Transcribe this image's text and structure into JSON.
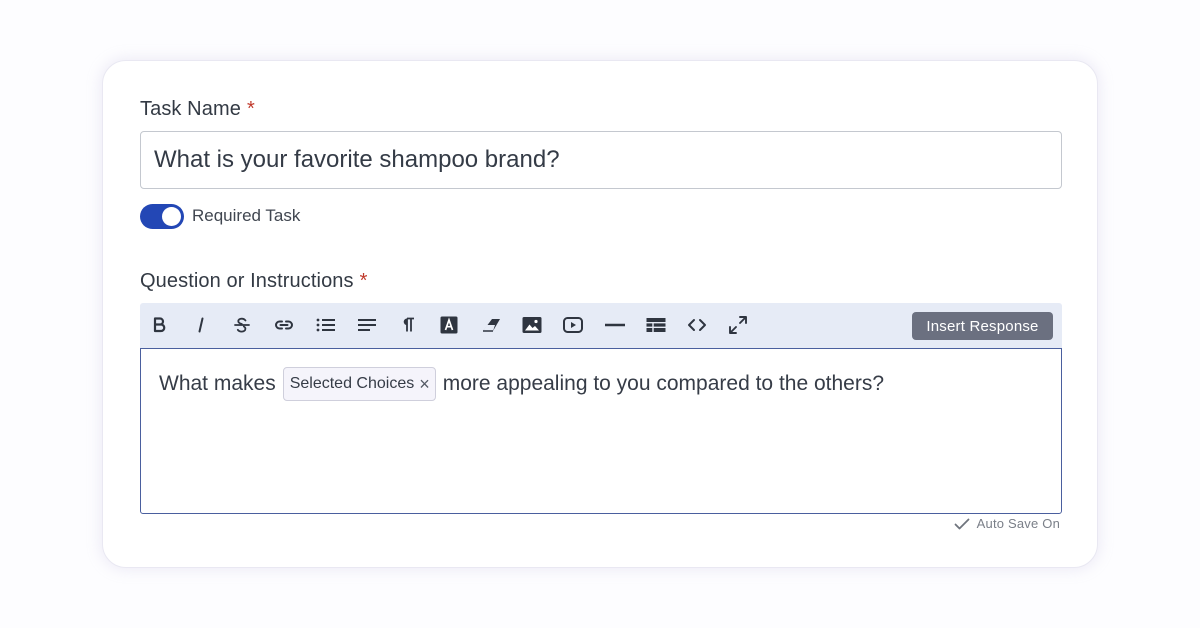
{
  "task_name": {
    "label": "Task Name",
    "required_marker": "*",
    "value": "What is your favorite shampoo brand?"
  },
  "required_toggle": {
    "label": "Required Task",
    "on": true,
    "color": "#2347b5"
  },
  "question": {
    "label": "Question or Instructions",
    "required_marker": "*",
    "toolbar": {
      "buttons": [
        "bold-icon",
        "italic-icon",
        "strikethrough-icon",
        "link-icon",
        "bulleted-list-icon",
        "align-icon",
        "paragraph-icon",
        "text-color-icon",
        "eraser-icon",
        "image-icon",
        "video-icon",
        "horizontal-rule-icon",
        "table-icon",
        "code-view-icon",
        "fullscreen-icon"
      ],
      "insert_response_label": "Insert Response"
    },
    "content": {
      "before": "What makes",
      "chip_label": "Selected Choices",
      "chip_close": "×",
      "after": "more appealing to you compared to the others?"
    }
  },
  "autosave_label": "Auto Save On"
}
